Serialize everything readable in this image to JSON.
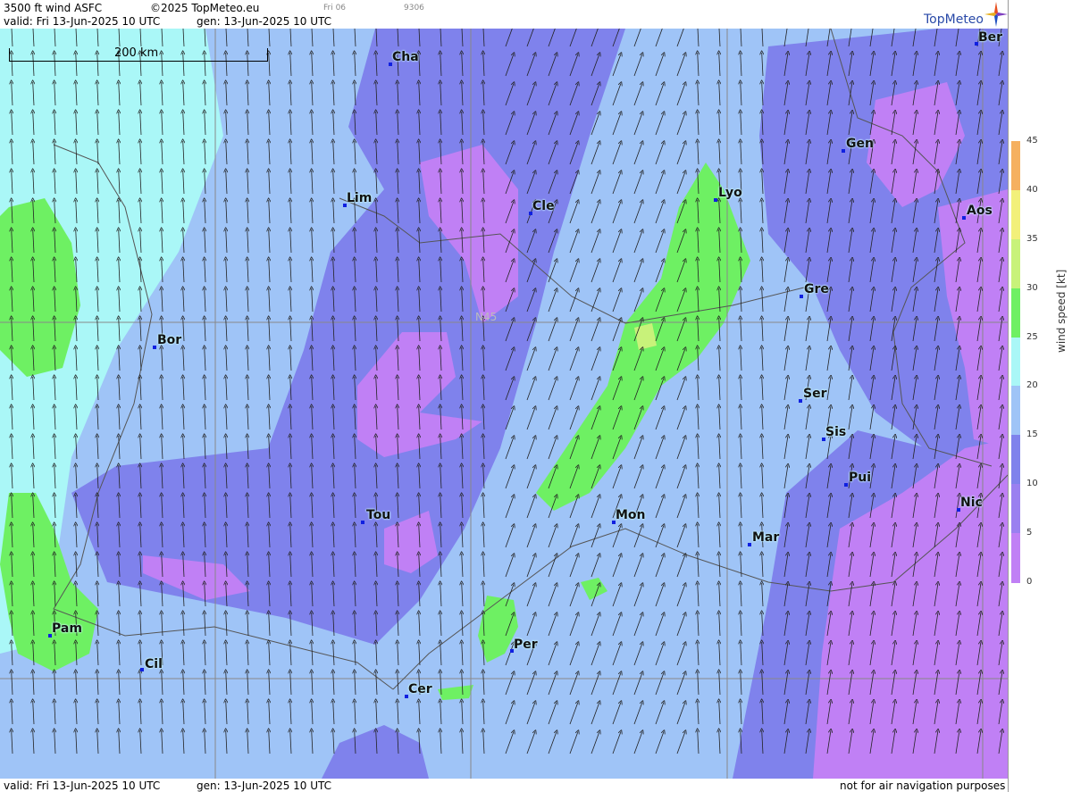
{
  "header": {
    "product": "3500 ft wind ASFC",
    "copyright": "©2025 TopMeteo.eu",
    "day_tab": "Fri 06",
    "code": "9306",
    "valid": "valid:  Fri  13-Jun-2025  10 UTC",
    "gen": "gen: 13-Jun-2025 10 UTC",
    "brand": "TopMeteo"
  },
  "footer": {
    "valid": "valid:  Fri  13-Jun-2025  10 UTC",
    "gen": "gen: 13-Jun-2025 10 UTC",
    "disclaimer": "not for air navigation purposes"
  },
  "map": {
    "scale_label": "200 km",
    "grid_label": "N45",
    "cities": [
      {
        "abbr": "Cha"
      },
      {
        "abbr": "Ber"
      },
      {
        "abbr": "Gen"
      },
      {
        "abbr": "Lim"
      },
      {
        "abbr": "Cle"
      },
      {
        "abbr": "Lyo"
      },
      {
        "abbr": "Aos"
      },
      {
        "abbr": "Gre"
      },
      {
        "abbr": "Bor"
      },
      {
        "abbr": "Ser"
      },
      {
        "abbr": "Sis"
      },
      {
        "abbr": "Pui"
      },
      {
        "abbr": "Tou"
      },
      {
        "abbr": "Mon"
      },
      {
        "abbr": "Mar"
      },
      {
        "abbr": "Nic"
      },
      {
        "abbr": "Pam"
      },
      {
        "abbr": "Cil"
      },
      {
        "abbr": "Per"
      },
      {
        "abbr": "Cer"
      }
    ]
  },
  "legend": {
    "title": "wind  speed  [kt]",
    "ticks": [
      "45",
      "40",
      "35",
      "30",
      "25",
      "20",
      "15",
      "10",
      "5",
      "0"
    ],
    "colors": {
      "0": "#c080f5",
      "5": "#9a80f0",
      "10": "#7f82ec",
      "15": "#9fc4f7",
      "20": "#aaf7f7",
      "25": "#6ef063",
      "30": "#c8f27a",
      "35": "#f2f07a",
      "40": "#f5b060",
      "45": "#f07070"
    }
  }
}
